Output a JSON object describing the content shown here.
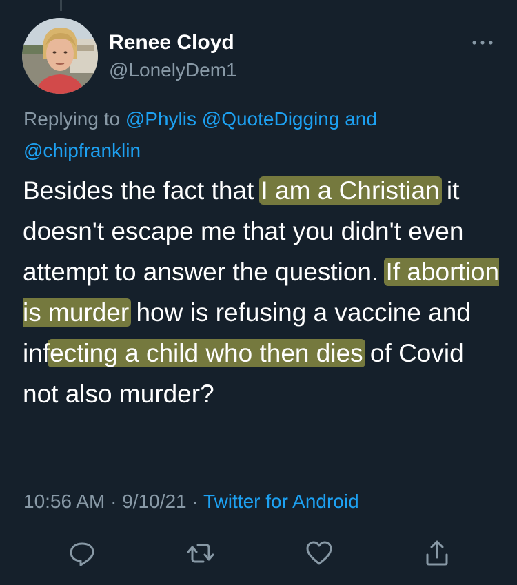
{
  "tweet": {
    "author": {
      "display_name": "Renee Cloyd",
      "handle": "@LonelyDem1",
      "avatar_icon": "profile-photo"
    },
    "more_icon": "ellipsis-icon",
    "reply_context": {
      "prefix": "Replying to",
      "mentions": [
        "@Phylis",
        "@QuoteDigging",
        "@chipfranklin"
      ],
      "conjunction": "and"
    },
    "text": {
      "s1": "Besides the fact that ",
      "h1": "I am a Christian",
      "s2": " it doesn't escape me that you didn't even attempt to answer the question. ",
      "h2": "If abortion is murder",
      "s3": " how is refusing a vaccine and inf",
      "h3": "ecting a child who then dies",
      "s4": " of Covid not also murder?"
    },
    "highlight_color": "#ece756",
    "meta": {
      "time": "10:56 AM",
      "separator": "·",
      "date": "9/10/21",
      "source": "Twitter for Android"
    },
    "actions": [
      {
        "icon": "reply-icon"
      },
      {
        "icon": "retweet-icon"
      },
      {
        "icon": "like-icon"
      },
      {
        "icon": "share-icon"
      }
    ]
  },
  "colors": {
    "background": "#15202b",
    "text_primary": "#ffffff",
    "text_secondary": "#8899a6",
    "link": "#1da1f2"
  }
}
